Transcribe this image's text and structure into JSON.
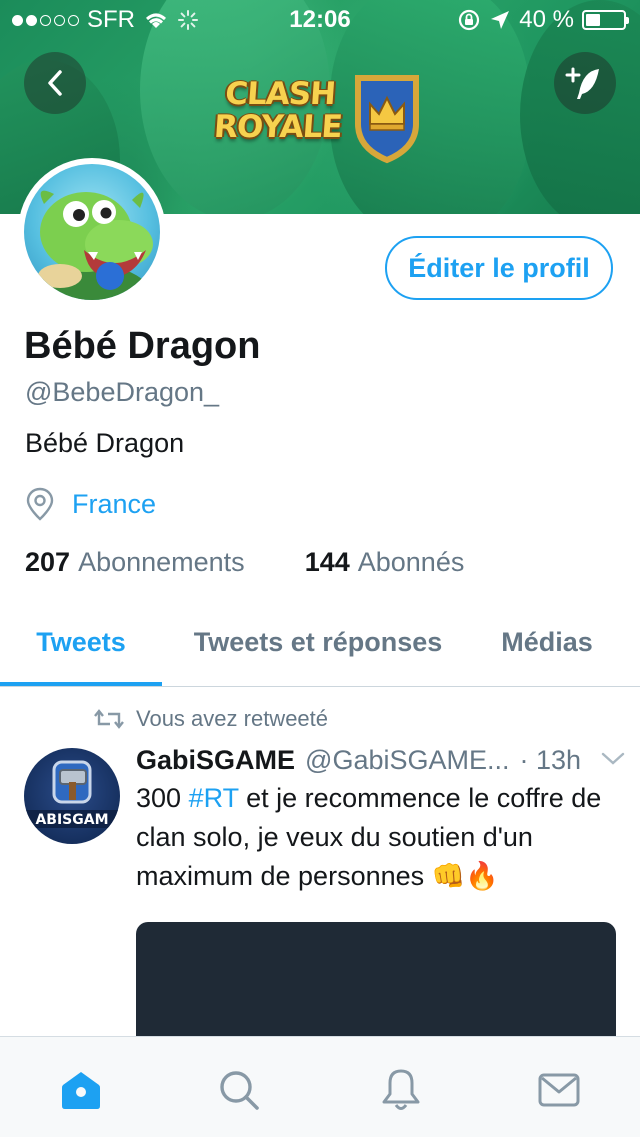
{
  "status_bar": {
    "carrier": "SFR",
    "time": "12:06",
    "battery_text": "40 %",
    "battery_level": 0.4
  },
  "banner": {
    "logo_line1": "CLASH",
    "logo_line2": "ROYALE"
  },
  "profile": {
    "name": "Bébé Dragon",
    "handle": "@BebeDragon_",
    "bio": "Bébé Dragon",
    "location": "France",
    "edit_button": "Éditer le profil",
    "following_count": "207",
    "following_label": "Abonnements",
    "followers_count": "144",
    "followers_label": "Abonnés"
  },
  "tabs": [
    {
      "label": "Tweets",
      "active": true
    },
    {
      "label": "Tweets et réponses",
      "active": false
    },
    {
      "label": "Médias",
      "active": false
    }
  ],
  "tweet": {
    "retweet_label": "Vous avez retweeté",
    "author_name": "GabiSGAME",
    "author_handle": "@GabiSGAME...",
    "time": "· 13h",
    "text_before": "300 ",
    "hashtag": "#RT",
    "text_after": " et je recommence le coffre de clan solo, je veux du soutien d'un maximum de personnes 👊🔥",
    "avatar_text": "ABISGAM"
  },
  "bottom_bar": [
    "home-icon",
    "search-icon",
    "notifications-icon",
    "messages-icon"
  ],
  "colors": {
    "accent": "#1da1f2",
    "secondary_text": "#657786",
    "primary_text": "#14171a"
  }
}
